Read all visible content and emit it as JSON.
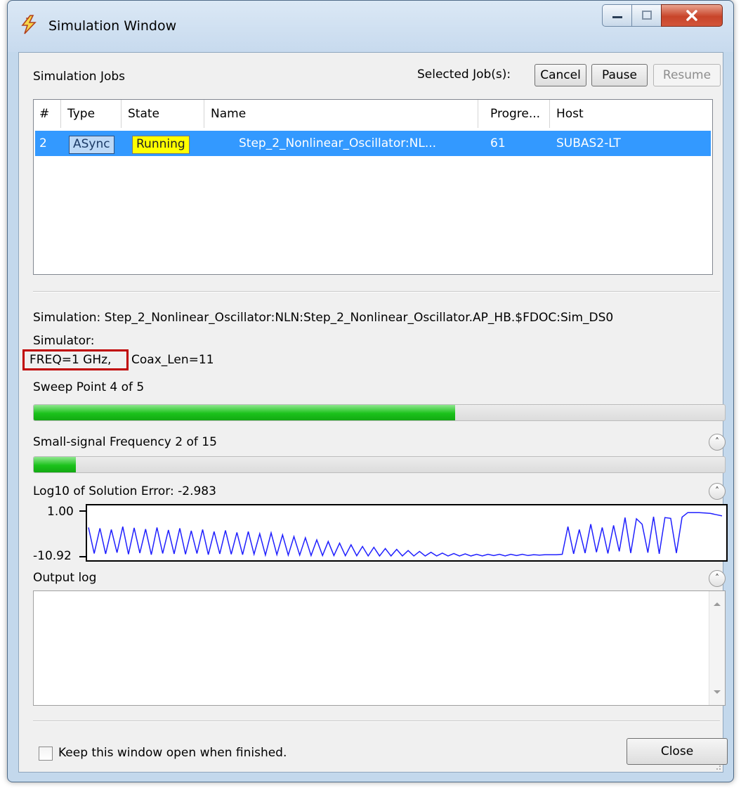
{
  "window": {
    "title": "Simulation Window",
    "buttons": [
      "minimize-icon",
      "maximize-icon",
      "close-icon"
    ]
  },
  "jobs_section": {
    "title": "Simulation Jobs",
    "selected_label": "Selected Job(s):",
    "cancel_label": "Cancel",
    "pause_label": "Pause",
    "resume_label": "Resume",
    "columns": [
      "#",
      "Type",
      "State",
      "Name",
      "Progre...",
      "Host"
    ],
    "rows": [
      {
        "num": "2",
        "type": "ASync",
        "state": "Running",
        "name": "Step_2_Nonlinear_Oscillator:NL...",
        "progress": "61",
        "host": "SUBAS2-LT",
        "selected": true
      }
    ]
  },
  "details": {
    "simulation_line": "Simulation: Step_2_Nonlinear_Oscillator:NLN:Step_2_Nonlinear_Oscillator.AP_HB.$FDOC:Sim_DS0",
    "simulator_line": "Simulator:",
    "freq_param": "FREQ=1 GHz,",
    "coax_param": "Coax_Len=11",
    "sweep_label": "Sweep Point 4 of 5",
    "sweep_progress": 0.61,
    "small_signal_label": "Small-signal Frequency 2 of 15",
    "small_signal_progress": 0.061,
    "error_label": "Log10 of Solution Error: -2.983",
    "error_ymax": "1.00",
    "error_ymin": "-10.92",
    "error_series": [
      -4.0,
      -10.3,
      -4.2,
      -10.4,
      -4.5,
      -10.1,
      -3.8,
      -10.5,
      -4.1,
      -10.2,
      -4.4,
      -10.6,
      -4.0,
      -10.3,
      -4.6,
      -10.4,
      -4.2,
      -10.5,
      -4.8,
      -10.3,
      -4.5,
      -10.6,
      -5.0,
      -10.4,
      -4.7,
      -10.5,
      -5.2,
      -10.6,
      -5.0,
      -10.5,
      -5.5,
      -10.7,
      -5.3,
      -10.6,
      -5.8,
      -10.7,
      -6.2,
      -10.7,
      -6.5,
      -10.8,
      -7.0,
      -10.8,
      -7.4,
      -10.8,
      -7.8,
      -10.85,
      -8.2,
      -10.85,
      -8.6,
      -10.9,
      -8.8,
      -10.9,
      -9.1,
      -10.9,
      -9.3,
      -10.9,
      -9.6,
      -10.9,
      -9.8,
      -10.9,
      -10.0,
      -10.9,
      -10.2,
      -10.9,
      -10.3,
      -10.9,
      -10.4,
      -10.9,
      -10.5,
      -10.9,
      -10.5,
      -10.8,
      -10.5,
      -10.9,
      -10.5,
      -10.8,
      -10.5,
      -10.8,
      -10.6,
      -10.7,
      -10.6,
      -10.6,
      -10.6,
      -10.5,
      -3.8,
      -10.4,
      -4.5,
      -10.2,
      -3.2,
      -10.0,
      -4.0,
      -10.3,
      -3.5,
      -9.8,
      -1.6,
      -10.2,
      -1.9,
      -3.2,
      -10.1,
      -1.4,
      -10.4,
      -1.6,
      -1.8,
      -10.2,
      -1.5,
      -0.4,
      -0.4,
      -0.4,
      -0.5,
      -0.6,
      -0.9,
      -1.2
    ]
  },
  "output_log": {
    "title": "Output log"
  },
  "footer": {
    "keep_open_label": "Keep this window open when finished.",
    "keep_open_checked": false,
    "close_label": "Close"
  }
}
